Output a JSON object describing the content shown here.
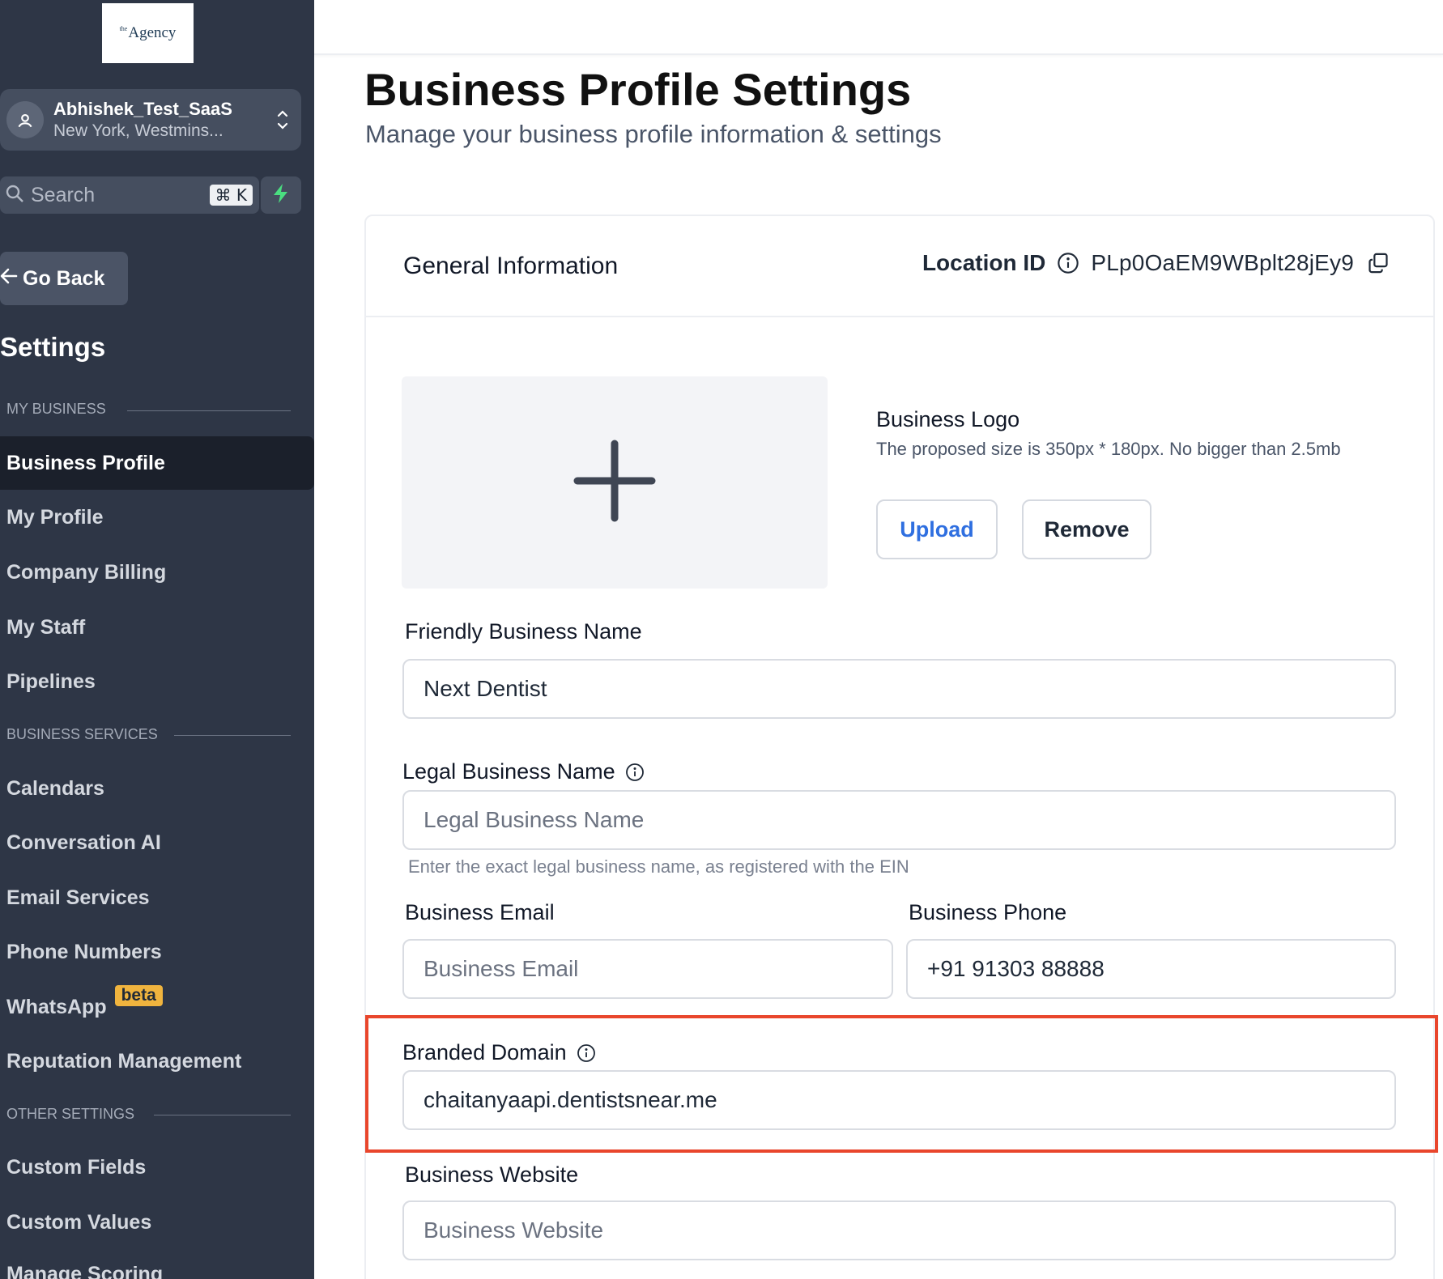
{
  "sidebar": {
    "logo": "the Agency",
    "logo_small": "the",
    "logo_main": "Agency",
    "account": {
      "name": "Abhishek_Test_SaaS",
      "location": "New York, Westmins..."
    },
    "search": {
      "label": "Search",
      "shortcut": "⌘ K"
    },
    "go_back": "Go Back",
    "settings_title": "Settings",
    "sections": {
      "my_business": "MY BUSINESS",
      "business_services": "BUSINESS SERVICES",
      "other_settings": "OTHER SETTINGS"
    },
    "items": {
      "business_profile": "Business Profile",
      "my_profile": "My Profile",
      "company_billing": "Company Billing",
      "my_staff": "My Staff",
      "pipelines": "Pipelines",
      "calendars": "Calendars",
      "conversation_ai": "Conversation AI",
      "email_services": "Email Services",
      "phone_numbers": "Phone Numbers",
      "whatsapp": "WhatsApp",
      "whatsapp_badge": "beta",
      "reputation_management": "Reputation Management",
      "custom_fields": "Custom Fields",
      "custom_values": "Custom Values",
      "manage_scoring": "Manage Scoring"
    },
    "colors": {
      "background": "#2e3646",
      "active": "#1b202b",
      "bolt": "#4ade80",
      "badge": "#f0b43e"
    }
  },
  "header": {
    "title": "Business Profile Settings",
    "subtitle": "Manage your business profile information & settings"
  },
  "card": {
    "title": "General Information",
    "location_id_label": "Location ID",
    "location_id_value": "PLp0OaEM9WBplt28jEy9",
    "logo": {
      "title": "Business Logo",
      "hint": "The proposed size is 350px * 180px. No bigger than 2.5mb",
      "upload_label": "Upload",
      "remove_label": "Remove"
    },
    "fields": {
      "friendly_name": {
        "label": "Friendly Business Name",
        "value": "Next Dentist"
      },
      "legal_name": {
        "label": "Legal Business Name",
        "placeholder": "Legal Business Name",
        "helper": "Enter the exact legal business name, as registered with the EIN"
      },
      "email": {
        "label": "Business Email",
        "placeholder": "Business Email"
      },
      "phone": {
        "label": "Business Phone",
        "value": "+91 91303 88888"
      },
      "branded_domain": {
        "label": "Branded Domain",
        "value": "chaitanyaapi.dentistsnear.me"
      },
      "website": {
        "label": "Business Website",
        "placeholder": "Business Website"
      }
    },
    "colors": {
      "accent": "#2f6fe0",
      "highlight": "#e9462c"
    }
  }
}
